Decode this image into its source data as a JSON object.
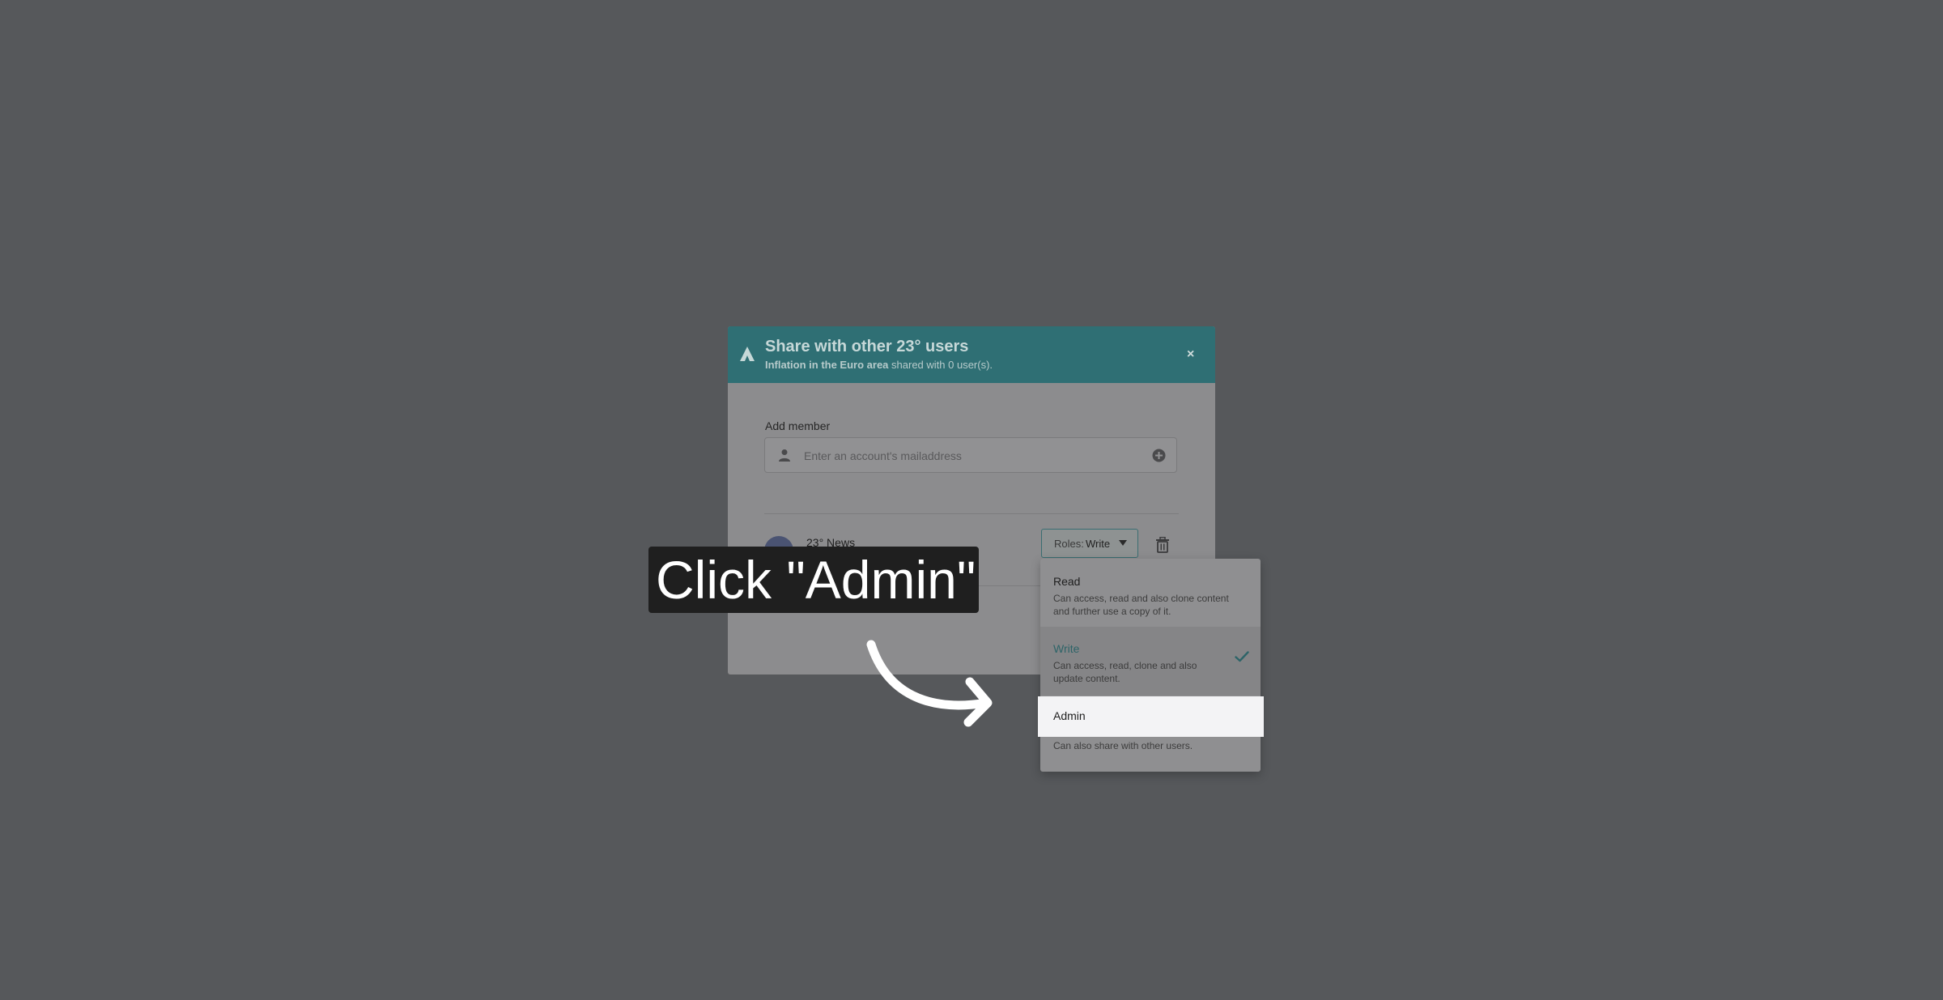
{
  "modal": {
    "title": "Share with other 23° users",
    "subtitle_doc": "Inflation in the Euro area",
    "subtitle_rest": " shared with 0 user(s).",
    "close_label": "×"
  },
  "add_member": {
    "label": "Add member",
    "placeholder": "Enter an account's mailaddress"
  },
  "members": [
    {
      "name": "23° News",
      "roles_label": "Roles:",
      "role_value": "Write"
    }
  ],
  "roles_dropdown": {
    "options": [
      {
        "title": "Read",
        "description": "Can access, read and also clone content and further use a copy of it.",
        "selected": false
      },
      {
        "title": "Write",
        "description": "Can access, read, clone and also update content.",
        "selected": true
      },
      {
        "title": "Admin",
        "description": "Can also share with other users.",
        "selected": false
      }
    ]
  },
  "tutorial": {
    "instruction": "Click \"Admin\""
  },
  "colors": {
    "header_teal": "#2f6f74",
    "accent_teal": "#2d6468",
    "overlay": "#3c3c3e",
    "highlight": "#f3f3f5",
    "callout_bg": "#1f1f1f"
  },
  "icons": {
    "logo": "triangle-logo-icon",
    "close": "close-icon",
    "user": "user-icon",
    "add": "add-circle-icon",
    "dropdown": "chevron-down-icon",
    "delete": "trash-icon",
    "selected": "check-icon",
    "pointer": "curved-arrow-icon"
  }
}
